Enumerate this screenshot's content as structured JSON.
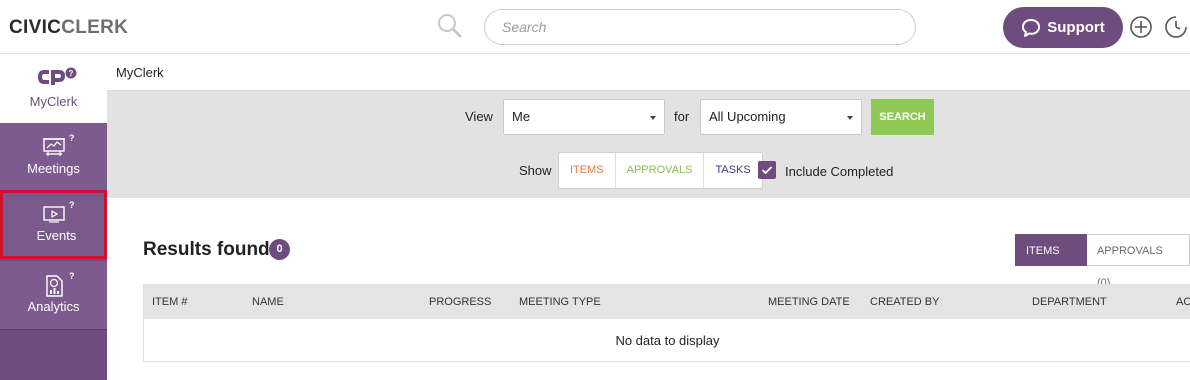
{
  "header": {
    "logo_part1": "CIVIC",
    "logo_part2": "CLERK",
    "search_placeholder": "Search",
    "support_label": "Support"
  },
  "sidebar": {
    "myclerk_label": "MyClerk",
    "items": [
      {
        "label": "Meetings",
        "help": "?",
        "icon": "presentation-icon"
      },
      {
        "label": "Events",
        "help": "?",
        "icon": "video-icon"
      },
      {
        "label": "Analytics",
        "help": "?",
        "icon": "report-icon"
      }
    ]
  },
  "breadcrumb": "MyClerk",
  "filters": {
    "view_label": "View",
    "view_value": "Me",
    "for_label": "for",
    "for_value": "All Upcoming",
    "search_button": "SEARCH",
    "show_label": "Show",
    "show_options": [
      "ITEMS",
      "APPROVALS",
      "TASKS"
    ],
    "include_completed_label": "Include Completed",
    "include_completed_checked": true
  },
  "results": {
    "title": "Results found:",
    "count": "0",
    "tabs": [
      "ITEMS (0)",
      "APPROVALS (0)"
    ],
    "columns": [
      "ITEM #",
      "NAME",
      "PROGRESS",
      "MEETING TYPE",
      "MEETING DATE",
      "CREATED BY",
      "DEPARTMENT",
      "AC"
    ],
    "empty_text": "No data to display"
  },
  "colors": {
    "brand_purple": "#6e4d7e",
    "search_green": "#8fc955",
    "highlight_red": "#d0112b"
  }
}
